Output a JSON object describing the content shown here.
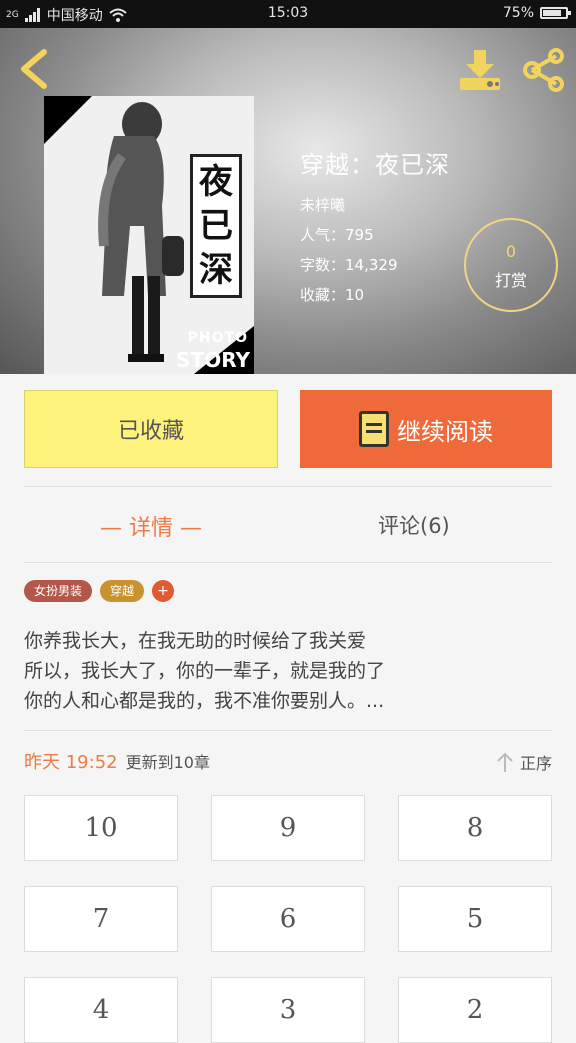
{
  "status_bar": {
    "carrier": "中国移动",
    "network": "2G",
    "time": "15:03",
    "battery": "75%",
    "battery_level": 0.75
  },
  "header": {
    "back_icon": "chevron-left-icon",
    "download_icon": "download-icon",
    "share_icon": "share-icon"
  },
  "book": {
    "cover_title_chars": [
      "夜",
      "已",
      "深"
    ],
    "cover_photo": "PHOTO",
    "cover_story": "STORY",
    "title": "穿越：夜已深",
    "author": "未梓曦",
    "popularity": "人气：795",
    "word_count": "字数：14,329",
    "favorites": "收藏：10"
  },
  "reward": {
    "count": "0",
    "label": "打赏"
  },
  "actions": {
    "favorited_label": "已收藏",
    "continue_label": "继续阅读"
  },
  "tabs": {
    "detail": "— 详情 —",
    "comments": "评论(6)"
  },
  "tags": [
    "女扮男装",
    "穿越"
  ],
  "tag_add": "+",
  "description": [
    "你养我长大，在我无助的时候给了我关爱",
    "所以，我长大了，你的一辈子，就是我的了",
    "你的人和心都是我的，我不准你要别人。..."
  ],
  "update": {
    "time": "昨天 19:52",
    "text": "更新到10章"
  },
  "order_label": "正序",
  "chapters": [
    "10",
    "9",
    "8",
    "7",
    "6",
    "5",
    "4",
    "3",
    "2"
  ],
  "colors": {
    "accent_orange": "#ee6a3b",
    "favorite_yellow": "#fdf27c",
    "icon_yellow": "#f7df74"
  }
}
